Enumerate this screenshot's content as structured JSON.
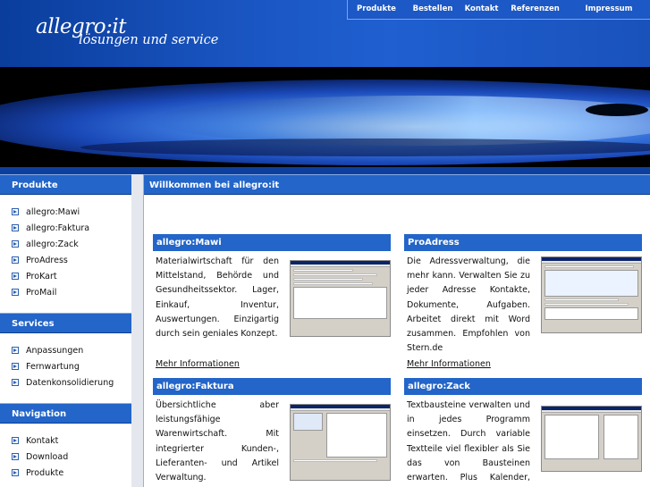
{
  "logo": {
    "main": "allegro:it",
    "sub": "lösungen und service"
  },
  "topnav": [
    "Produkte",
    "Bestellen",
    "Kontakt",
    "Referenzen",
    "Impressum"
  ],
  "sidebar": {
    "produkte": {
      "title": "Produkte",
      "items": [
        "allegro:Mawi",
        "allegro:Faktura",
        "allegro:Zack",
        "ProAdress",
        "ProKart",
        "ProMail"
      ]
    },
    "services": {
      "title": "Services",
      "items": [
        "Anpassungen",
        "Fernwartung",
        "Datenkonsolidierung"
      ]
    },
    "navigation": {
      "title": "Navigation",
      "items": [
        "Kontakt",
        "Download",
        "Produkte"
      ]
    }
  },
  "main": {
    "title": "Willkommen bei allegro:it",
    "boxes": [
      {
        "title": "allegro:Mawi",
        "text": "Materialwirtschaft für den Mittelstand, Behörde und Gesundheitssektor. Lager, Einkauf, Inventur, Auswertungen. Einzigartig durch sein geniales Konzept.",
        "more": "Mehr Informationen"
      },
      {
        "title": "ProAdress",
        "text": "Die Adressverwaltung, die mehr kann. Verwalten Sie zu jeder Adresse Kontakte, Dokumente, Aufgaben. Arbeitet direkt mit Word zusammen. Empfohlen von Stern.de",
        "more": "Mehr Informationen"
      },
      {
        "title": "allegro:Faktura",
        "text": "Übersichtliche aber leistungsfähige Warenwirtschaft. Mit integrierter Kunden-, Lieferanten- und Artikel Verwaltung. Branchenneutral"
      },
      {
        "title": "allegro:Zack",
        "text": "Textbausteine verwalten und in jedes Programm einsetzen. Durch variable Textteile viel flexibler als Sie das von Bausteinen erwarten. Plus Kalender, favorisierte"
      }
    ]
  },
  "colors": {
    "header": "#1b57c4",
    "bar": "#2365c8",
    "stripe": "#0d3f9e",
    "banner": "#000000"
  }
}
